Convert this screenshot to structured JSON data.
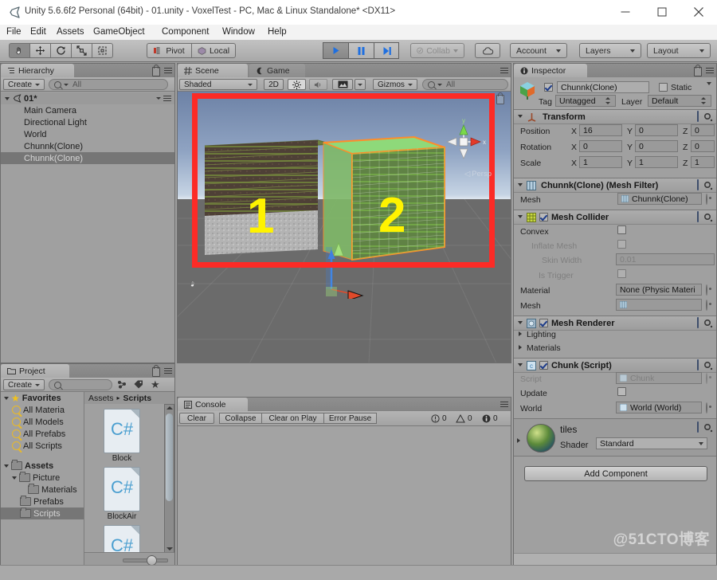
{
  "window": {
    "title": "Unity 5.6.6f2 Personal (64bit) - 01.unity - VoxelTest - PC, Mac & Linux Standalone* <DX11>",
    "app_icon": "unity-icon",
    "minimize": "minimize-icon",
    "maximize": "maximize-icon",
    "close": "close-icon"
  },
  "menubar": {
    "items": [
      {
        "label": "File"
      },
      {
        "label": "Edit"
      },
      {
        "label": "Assets"
      },
      {
        "label": "GameObject"
      },
      {
        "label": "Component"
      },
      {
        "label": "Window"
      },
      {
        "label": "Help"
      }
    ]
  },
  "toolbar": {
    "transform_tools": [
      {
        "name": "hand-tool",
        "icon": "hand-icon",
        "active": true
      },
      {
        "name": "move-tool",
        "icon": "move-arrows-icon",
        "active": false
      },
      {
        "name": "rotate-tool",
        "icon": "rotate-icon",
        "active": false
      },
      {
        "name": "scale-tool",
        "icon": "scale-icon",
        "active": false
      },
      {
        "name": "rect-tool",
        "icon": "rect-transform-icon",
        "active": false
      }
    ],
    "pivot_label": "Pivot",
    "local_label": "Local",
    "play_label": "play-icon",
    "pause_label": "pause-icon",
    "step_label": "step-icon",
    "collab_label": "Collab",
    "cloud_label": "cloud-icon",
    "account_label": "Account",
    "layers_label": "Layers",
    "layout_label": "Layout"
  },
  "hierarchy": {
    "tab_label": "Hierarchy",
    "create_label": "Create",
    "search_placeholder": "All",
    "scene_name": "01*",
    "items": [
      {
        "label": "Main Camera",
        "selected": false
      },
      {
        "label": "Directional Light",
        "selected": false
      },
      {
        "label": "World",
        "selected": false
      },
      {
        "label": "Chunnk(Clone)",
        "selected": false
      },
      {
        "label": "Chunnk(Clone)",
        "selected": true
      }
    ]
  },
  "scene": {
    "tab_scene": "Scene",
    "tab_game": "Game",
    "draw_mode": "Shaded",
    "twod_label": "2D",
    "lighting_icon": "sun-icon",
    "audio_icon": "speaker-icon",
    "effects_icon": "image-icon",
    "gizmos_label": "Gizmos",
    "search_placeholder": "All",
    "persp_label": "Persp",
    "gizmo_axis_x": "x",
    "gizmo_axis_y": "y",
    "annotation_1": "1",
    "annotation_2": "2",
    "highlight_color": "#fc2b26",
    "annotation_color": "#fff300",
    "selection_outline_color": "#ff8c2a"
  },
  "project": {
    "tab_label": "Project",
    "create_label": "Create",
    "search_placeholder": "",
    "breadcrumb": [
      "Assets",
      "Scripts"
    ],
    "tree": [
      {
        "label": "Favorites",
        "icon": "star-icon",
        "depth": 0,
        "expanded": true,
        "selected": false
      },
      {
        "label": "All Materia",
        "icon": "search-icon",
        "depth": 1,
        "selected": false
      },
      {
        "label": "All Models",
        "icon": "search-icon",
        "depth": 1,
        "selected": false
      },
      {
        "label": "All Prefabs",
        "icon": "search-icon",
        "depth": 1,
        "selected": false
      },
      {
        "label": "All Scripts",
        "icon": "search-icon",
        "depth": 1,
        "selected": false
      },
      {
        "label": "Assets",
        "icon": "folder-icon",
        "depth": 0,
        "expanded": true,
        "selected": false
      },
      {
        "label": "Picture",
        "icon": "folder-icon",
        "depth": 1,
        "expanded": true,
        "selected": false
      },
      {
        "label": "Materials",
        "icon": "folder-icon",
        "depth": 2,
        "selected": false
      },
      {
        "label": "Prefabs",
        "icon": "folder-icon",
        "depth": 1,
        "selected": false
      },
      {
        "label": "Scripts",
        "icon": "folder-icon",
        "depth": 1,
        "selected": true
      }
    ],
    "assets": [
      {
        "label": "Block",
        "icon": "csharp-script-icon"
      },
      {
        "label": "BlockAir",
        "icon": "csharp-script-icon"
      },
      {
        "label": "",
        "icon": "csharp-script-icon"
      }
    ]
  },
  "console": {
    "tab_label": "Console",
    "clear_label": "Clear",
    "collapse_label": "Collapse",
    "clear_on_play_label": "Clear on Play",
    "error_pause_label": "Error Pause",
    "error_count": "0",
    "warning_count": "0",
    "info_count": "0"
  },
  "inspector": {
    "tab_label": "Inspector",
    "object_name": "Chunnk(Clone)",
    "enabled": true,
    "static_label": "Static",
    "tag_label": "Tag",
    "tag_value": "Untagged",
    "layer_label": "Layer",
    "layer_value": "Default",
    "transform": {
      "title": "Transform",
      "rows": [
        {
          "label": "Position",
          "x": "16",
          "y": "0",
          "z": "0"
        },
        {
          "label": "Rotation",
          "x": "0",
          "y": "0",
          "z": "0"
        },
        {
          "label": "Scale",
          "x": "1",
          "y": "1",
          "z": "1"
        }
      ],
      "axis_x": "X",
      "axis_y": "Y",
      "axis_z": "Z"
    },
    "mesh_filter": {
      "title": "Chunnk(Clone) (Mesh Filter)",
      "mesh_label": "Mesh",
      "mesh_value": "Chunnk(Clone)"
    },
    "mesh_collider": {
      "title": "Mesh Collider",
      "enabled": true,
      "convex_label": "Convex",
      "convex_checked": false,
      "inflate_label": "Inflate Mesh",
      "inflate_checked": false,
      "skin_width_label": "Skin Width",
      "skin_width_value": "0.01",
      "is_trigger_label": "Is Trigger",
      "is_trigger_checked": false,
      "material_label": "Material",
      "material_value": "None (Physic Materi",
      "mesh_label": "Mesh",
      "mesh_value": ""
    },
    "mesh_renderer": {
      "title": "Mesh Renderer",
      "enabled": true,
      "lighting_label": "Lighting",
      "materials_label": "Materials"
    },
    "chunk_script": {
      "title": "Chunk (Script)",
      "enabled": true,
      "script_label": "Script",
      "script_value": "Chunk",
      "update_label": "Update",
      "update_checked": false,
      "world_label": "World",
      "world_value": "World (World)"
    },
    "material": {
      "name": "tiles",
      "shader_label": "Shader",
      "shader_value": "Standard"
    },
    "add_component_label": "Add Component"
  },
  "watermark": "@51CTO博客"
}
